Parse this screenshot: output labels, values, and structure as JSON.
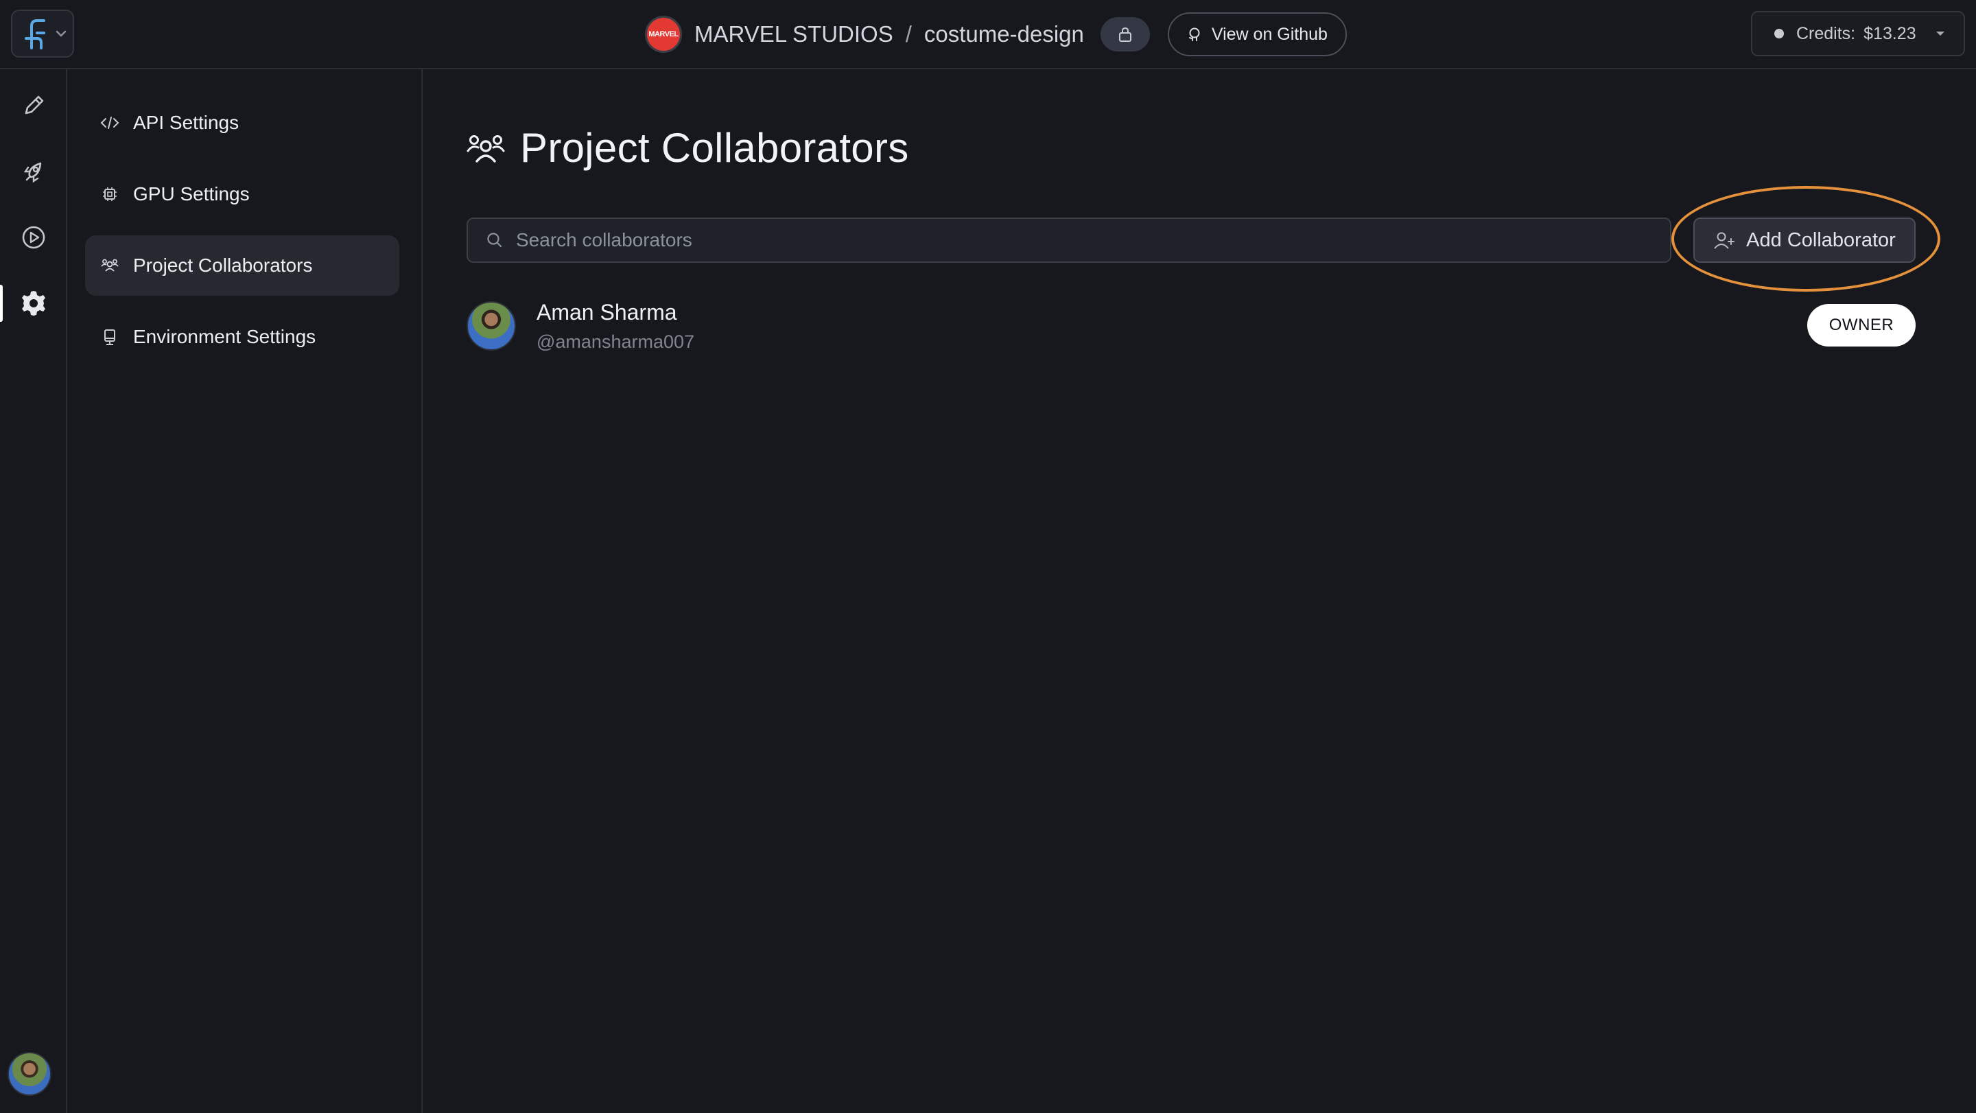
{
  "header": {
    "org_badge_text": "MARVEL",
    "org_name": "MARVEL STUDIOS",
    "separator": "/",
    "project_name": "costume-design",
    "github_label": "View on Github",
    "credits_label": "Credits:",
    "credits_value": "$13.23"
  },
  "rail": {
    "items": [
      "pencil-icon",
      "rocket-icon",
      "play-circle-icon",
      "gear-icon"
    ],
    "active": "gear-icon"
  },
  "settings_nav": {
    "items": [
      {
        "label": "API Settings",
        "icon": "code-icon"
      },
      {
        "label": "GPU Settings",
        "icon": "chip-icon"
      },
      {
        "label": "Project Collaborators",
        "icon": "users-icon",
        "active": true
      },
      {
        "label": "Environment Settings",
        "icon": "server-icon"
      }
    ]
  },
  "main": {
    "title": "Project Collaborators",
    "search_placeholder": "Search collaborators",
    "add_button_label": "Add Collaborator",
    "collaborators": [
      {
        "name": "Aman Sharma",
        "handle": "@amansharma007",
        "role": "OWNER"
      }
    ]
  },
  "colors": {
    "background": "#16181d",
    "highlight": "#e5903a",
    "accent": "#5aa9e6"
  }
}
